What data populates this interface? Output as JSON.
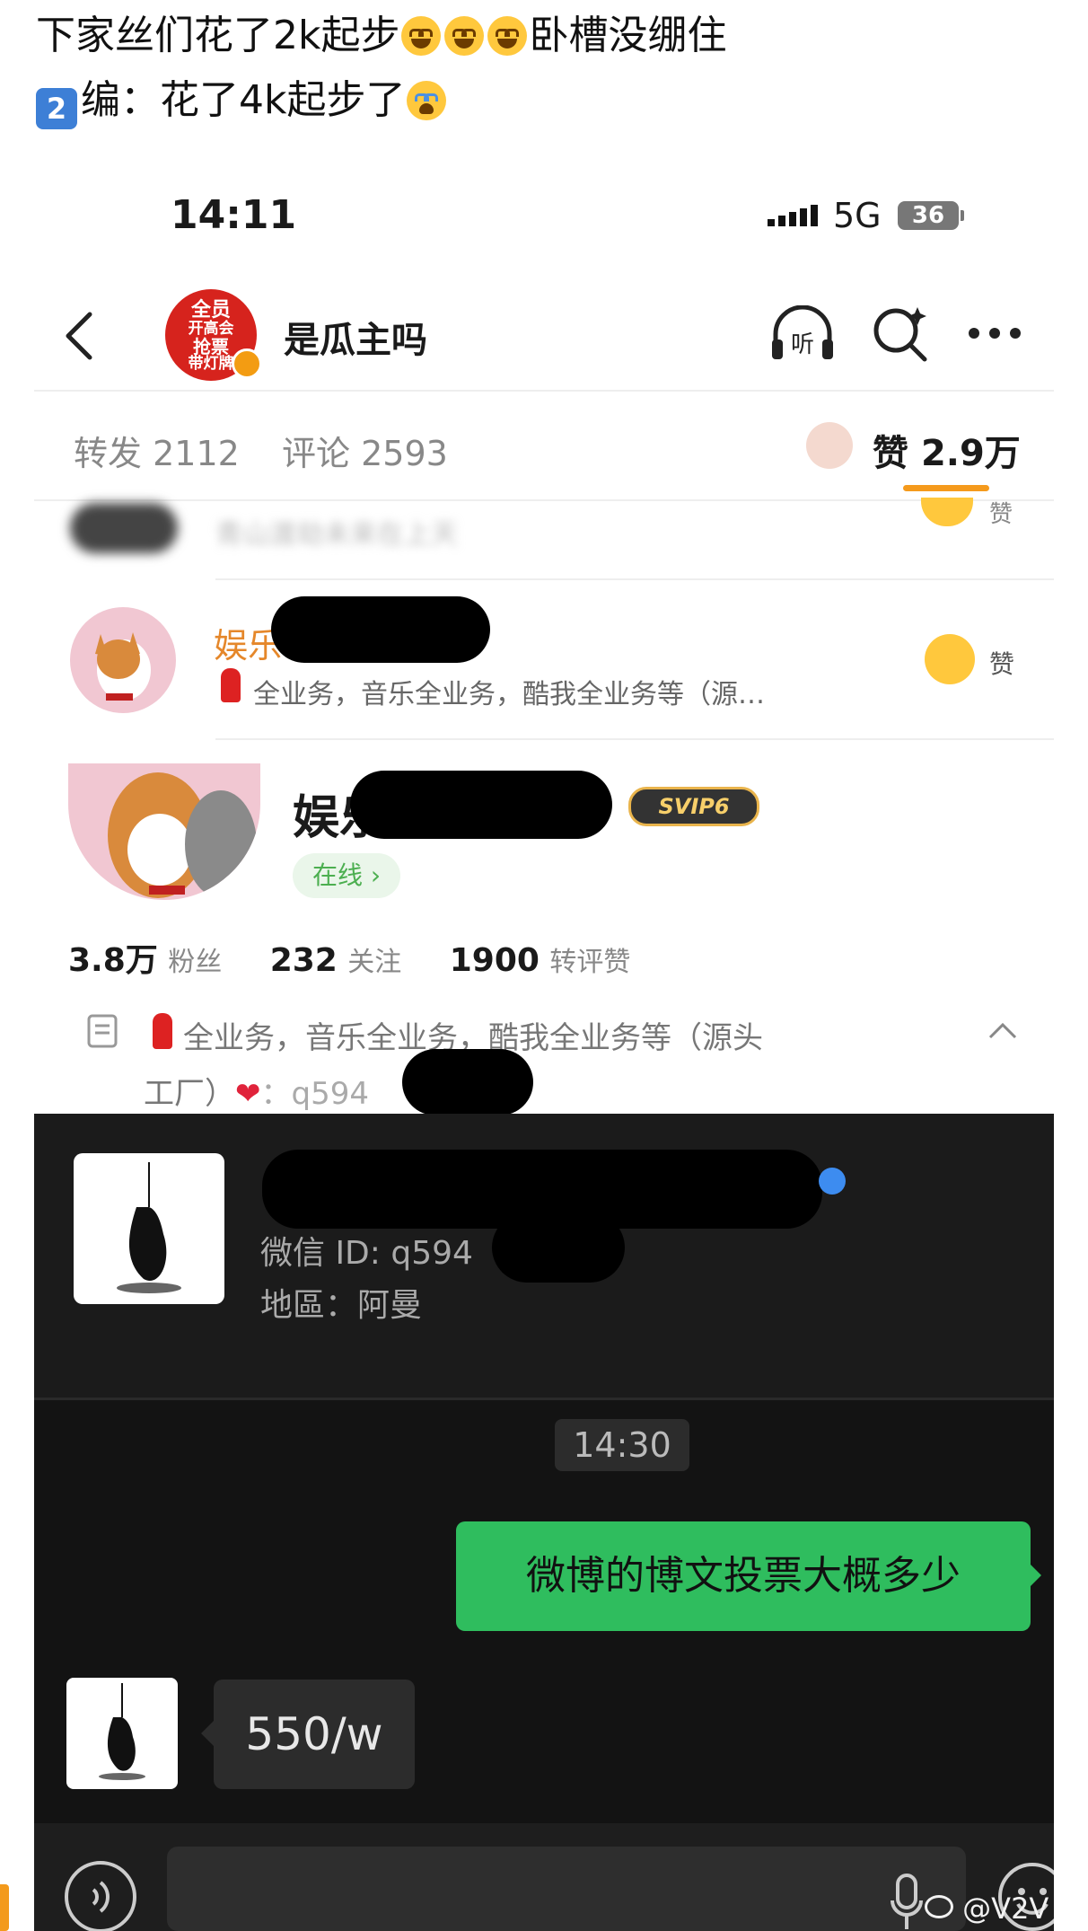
{
  "caption": {
    "line1_text": "下家丝们花了2k起步",
    "line1_suffix": "卧槽没绷住",
    "line2_badge": "2",
    "line2_text": "编：花了4k起步了"
  },
  "status_bar": {
    "time": "14:11",
    "network": "5G",
    "battery": "36"
  },
  "header": {
    "back_icon": "chevron-left-icon",
    "avatar_text": [
      "全员",
      "开高会",
      "抢票",
      "带灯牌"
    ],
    "title": "是瓜主吗"
  },
  "stats_bar": {
    "repost_label": "转发",
    "repost_count": "2112",
    "comment_label": "评论",
    "comment_count": "2593",
    "like_label": "赞",
    "like_count": "2.9万"
  },
  "list": {
    "row1_text": "青山渡劫未来在上天",
    "row1_like": "赞",
    "row2_name": "娱乐",
    "row2_desc": "全业务，音乐全业务，酷我全业务等（源…",
    "row2_like": "赞"
  },
  "profile": {
    "name": "娱乐",
    "vip_badge": "SVIP6",
    "online_label": "在线 ›",
    "fans_count": "3.8万",
    "fans_label": "粉丝",
    "follow_count": "232",
    "follow_label": "关注",
    "engage_count": "1900",
    "engage_label": "转评赞",
    "bio_line1": "全业务，音乐全业务，酷我全业务等（源头",
    "bio_line2_prefix": "工厂）",
    "bio_line2_value": "：q594"
  },
  "wechat": {
    "wechat_id_label": "微信 ID: q594",
    "region_label": "地區：阿曼",
    "timestamp": "14:30",
    "msg_out": "微博的博文投票大概多少",
    "msg_in": "550/w"
  },
  "watermark": "@V2V"
}
